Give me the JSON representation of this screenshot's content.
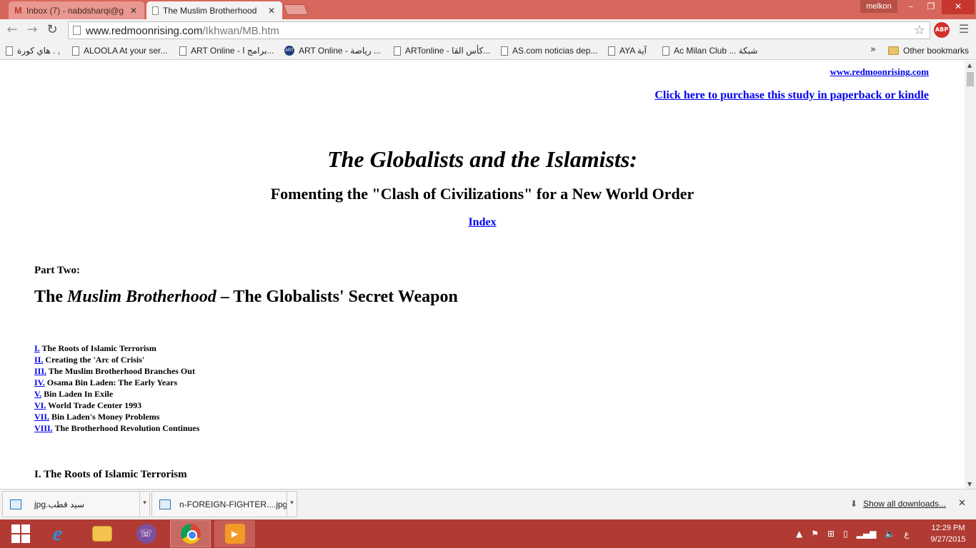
{
  "browser": {
    "tabs": [
      {
        "label": "Inbox (7) - nabdsharqi@g",
        "icon": "gmail-icon"
      },
      {
        "label": "The Muslim Brotherhood",
        "icon": "page-icon"
      }
    ],
    "user": "melkon",
    "url_host": "www.redmoonrising.com",
    "url_path": "/Ikhwan/MB.htm",
    "extension": "ABP",
    "bookmarks": [
      "هاي كورة . ,",
      "ALOOLA At your ser...",
      "ART Online - برامج ا...",
      "ART Online - رياضة ...",
      "ARTonline - كأس القا...",
      "AS.com noticias dep...",
      "AYA آية",
      "Ac Milan Club ... شبكة"
    ],
    "bookmarks_more": "»",
    "other_bookmarks": "Other bookmarks"
  },
  "page": {
    "site_link": "www.redmoonrising.com",
    "purchase_link": "Click here to purchase this study in paperback or kindle",
    "title": "The Globalists and the Islamists:",
    "subtitle": "Fomenting the \"Clash of Civilizations\" for a New World Order",
    "index_link": "Index",
    "part_label": "Part Two:",
    "part_title_pre": "The ",
    "part_title_em": "Muslim Brotherhood",
    "part_title_post": " – The Globalists' Secret Weapon",
    "toc": [
      {
        "num": "I.",
        "text": " The Roots of Islamic Terrorism"
      },
      {
        "num": "II.",
        "text": "Creating the 'Arc of Crisis'"
      },
      {
        "num": "III.",
        "text": "The Muslim Brotherhood Branches Out"
      },
      {
        "num": "IV.",
        "text": "Osama Bin Laden: The Early Years"
      },
      {
        "num": "V.",
        "text": " Bin Laden In Exile"
      },
      {
        "num": "VI.",
        "text": "World Trade Center 1993"
      },
      {
        "num": "VII.",
        "text": "Bin Laden's Money Problems"
      },
      {
        "num": "VIII.",
        "text": "The Brotherhood Revolution Continues"
      }
    ],
    "section_heading": "I. The Roots of Islamic Terrorism"
  },
  "downloads": {
    "items": [
      "سيد قطب.jpg",
      "n-FOREIGN-FIGHTER....jpg"
    ],
    "show_all": "Show all downloads..."
  },
  "taskbar": {
    "apps": [
      "start-icon",
      "internet-explorer-icon",
      "file-explorer-icon",
      "viber-icon",
      "chrome-icon",
      "media-player-icon"
    ],
    "language": "ع",
    "time": "12:29 PM",
    "date": "9/27/2015"
  }
}
